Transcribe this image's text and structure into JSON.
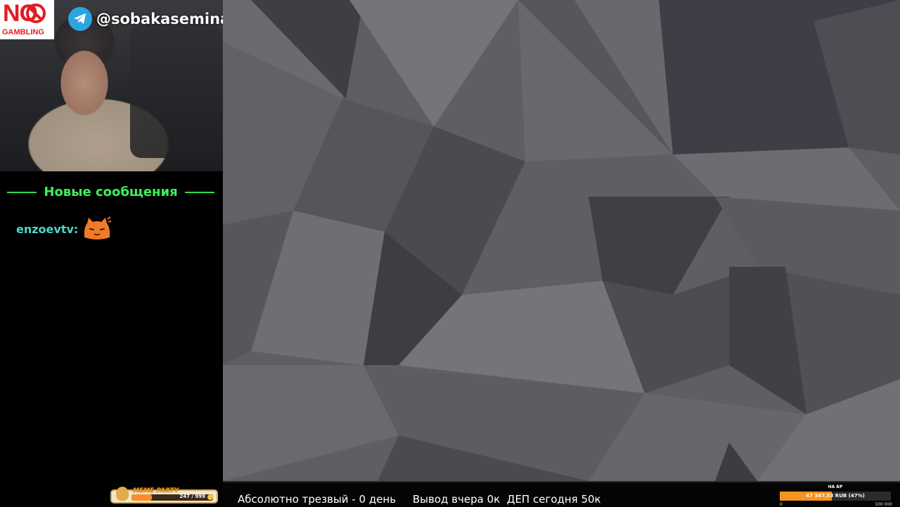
{
  "overlay": {
    "no_gambling": {
      "line1": "NO",
      "line2": "GAMBLING",
      "color": "#e21d24"
    },
    "telegram": {
      "handle": "@sobakasemina",
      "icon": "telegram-icon",
      "color": "#2ca5e0"
    }
  },
  "chat": {
    "header": "Новые сообщения",
    "header_color": "#3df05c",
    "messages": [
      {
        "user": "enzoevtv:",
        "emote": "cat-emote-icon",
        "user_color": "#4ed6c8"
      }
    ]
  },
  "meme_party": {
    "label": "MEME PARTY",
    "count": "247 / 999",
    "progress": 0.247,
    "icon": "coin-icon"
  },
  "status_bar": {
    "text": "Абсолютно трезвый - 0 день     Вывод вчера 0к  ДЕП сегодня 50к"
  },
  "goal": {
    "label": "НА БР",
    "amount": "47 347,53 RUB (47%)",
    "progress": 0.47,
    "min": "0",
    "max": "100 000",
    "color": "#f29322"
  }
}
